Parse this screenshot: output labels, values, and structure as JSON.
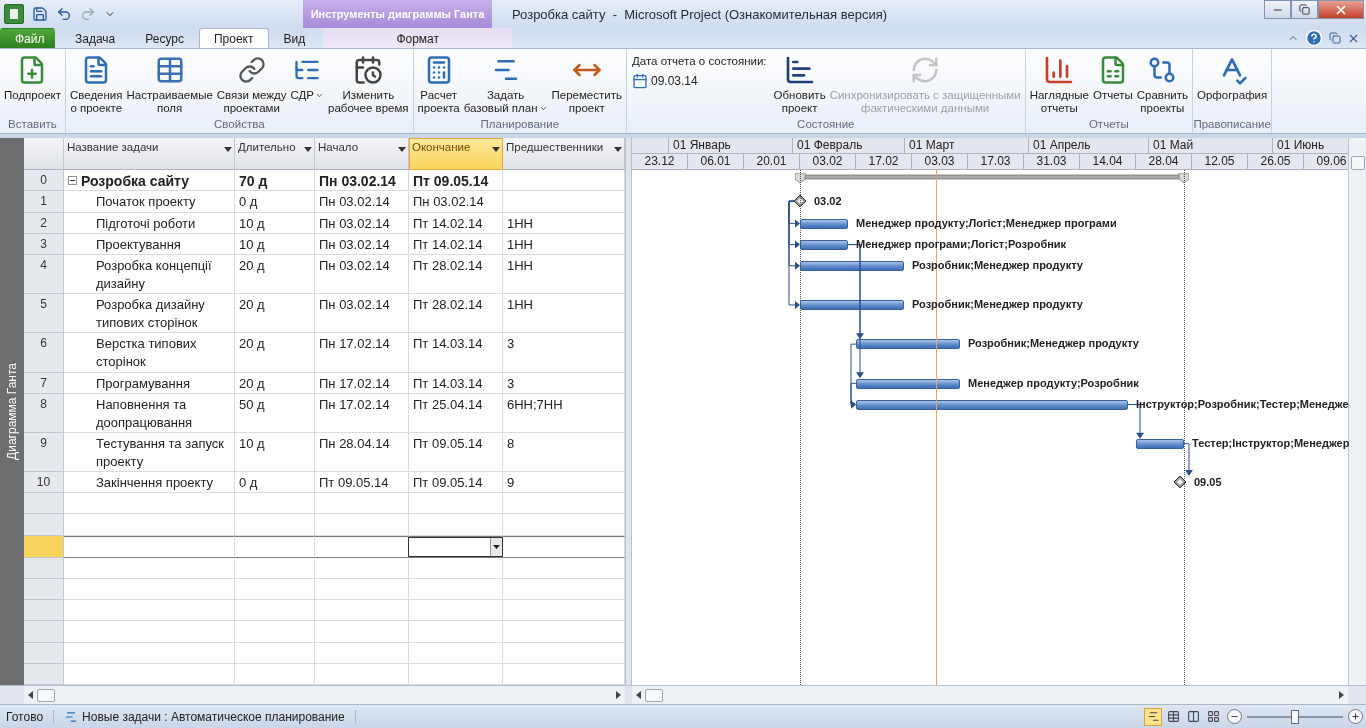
{
  "window": {
    "title": "Розробка сайту  -  Microsoft Project (Ознакомительная версия)"
  },
  "context_group": {
    "title": "Инструменты диаграммы Ганта"
  },
  "tabs": [
    {
      "label": "Файл",
      "kind": "file",
      "selected": false
    },
    {
      "label": "Задача",
      "kind": "tab",
      "selected": false
    },
    {
      "label": "Ресурс",
      "kind": "tab",
      "selected": false
    },
    {
      "label": "Проект",
      "kind": "tab",
      "selected": true
    },
    {
      "label": "Вид",
      "kind": "tab",
      "selected": false
    },
    {
      "label": "Формат",
      "kind": "context",
      "selected": false
    }
  ],
  "ribbon": {
    "groups": [
      {
        "label": "Вставить",
        "items": [
          {
            "kind": "button",
            "label": "Подпроект",
            "disabled": false,
            "dropdown": false
          }
        ]
      },
      {
        "label": "Свойства",
        "items": [
          {
            "kind": "button",
            "label": "Сведения\nо проекте",
            "disabled": false,
            "dropdown": false
          },
          {
            "kind": "button",
            "label": "Настраиваемые\nполя",
            "disabled": false,
            "dropdown": false
          },
          {
            "kind": "button",
            "label": "Связи между\nпроектами",
            "disabled": false,
            "dropdown": false
          },
          {
            "kind": "button",
            "label": "СДР",
            "disabled": false,
            "dropdown": true
          },
          {
            "kind": "button",
            "label": "Изменить\nрабочее время",
            "disabled": false,
            "dropdown": false
          }
        ]
      },
      {
        "label": "Планирование",
        "items": [
          {
            "kind": "button",
            "label": "Расчет\nпроекта",
            "disabled": false,
            "dropdown": false
          },
          {
            "kind": "button",
            "label": "Задать\nбазовый план",
            "disabled": false,
            "dropdown": true
          },
          {
            "kind": "button",
            "label": "Переместить\nпроект",
            "disabled": false,
            "dropdown": false
          }
        ]
      },
      {
        "label": "Состояние",
        "items": [
          {
            "kind": "date",
            "label": "Дата отчета о состоянии:",
            "value": "09.03.14"
          },
          {
            "kind": "button",
            "label": "Обновить\nпроект",
            "disabled": false,
            "dropdown": false
          },
          {
            "kind": "button",
            "label": "Синхронизировать с защищенными\nфактическими данными",
            "disabled": true,
            "dropdown": false
          }
        ]
      },
      {
        "label": "Отчеты",
        "items": [
          {
            "kind": "button",
            "label": "Наглядные\nотчеты",
            "disabled": false,
            "dropdown": false
          },
          {
            "kind": "button",
            "label": "Отчеты",
            "disabled": false,
            "dropdown": false
          },
          {
            "kind": "button",
            "label": "Сравнить\nпроекты",
            "disabled": false,
            "dropdown": false
          }
        ]
      },
      {
        "label": "Правописание",
        "items": [
          {
            "kind": "button",
            "label": "Орфография",
            "disabled": false,
            "dropdown": false
          }
        ]
      }
    ]
  },
  "view_bar": {
    "label": "Диаграмма Ганта"
  },
  "table": {
    "columns": [
      {
        "label": "Название задачи",
        "selected": false
      },
      {
        "label": "Длительно",
        "selected": false
      },
      {
        "label": "Начало",
        "selected": false
      },
      {
        "label": "Окончание",
        "selected": true
      },
      {
        "label": "Предшественники",
        "selected": false
      }
    ],
    "rows": [
      {
        "id": "0",
        "kind": "summary",
        "name": "Розробка сайту",
        "duration": "70 д",
        "start": "Пн 03.02.14",
        "finish": "Пт 09.05.14",
        "expanded": true,
        "children": [
          {
            "id": "1",
            "kind": "milestone",
            "name": "Початок проекту",
            "duration": "0 д",
            "start": "Пн 03.02.14",
            "finish": "Пн 03.02.14",
            "bar_label": "03.02"
          },
          {
            "id": "2",
            "kind": "task",
            "name": "Підготочі роботи",
            "duration": "10 д",
            "start": "Пн 03.02.14",
            "finish": "Пт 14.02.14",
            "predecessors": "1НН",
            "bar_label": "Менеджер продукту;Логіст;Менеджер програми"
          },
          {
            "id": "3",
            "kind": "task",
            "name": "Проектування",
            "duration": "10 д",
            "start": "Пн 03.02.14",
            "finish": "Пт 14.02.14",
            "predecessors": "1НН",
            "bar_label": "Менеджер програми;Логіст;Розробник"
          },
          {
            "id": "4",
            "kind": "task",
            "name": "Розробка концепції дизайну",
            "duration": "20 д",
            "start": "Пн 03.02.14",
            "finish": "Пт 28.02.14",
            "predecessors": "1НН",
            "bar_label": "Розробник;Менеджер продукту"
          },
          {
            "id": "5",
            "kind": "task",
            "name": "Розробка дизайну типових сторінок",
            "duration": "20 д",
            "start": "Пн 03.02.14",
            "finish": "Пт 28.02.14",
            "predecessors": "1НН",
            "bar_label": "Розробник;Менеджер продукту"
          },
          {
            "id": "6",
            "kind": "task",
            "name": "Верстка типових сторінок",
            "duration": "20 д",
            "start": "Пн 17.02.14",
            "finish": "Пт 14.03.14",
            "predecessors": "3",
            "bar_label": "Розробник;Менеджер продукту"
          },
          {
            "id": "7",
            "kind": "task",
            "name": "Програмування",
            "duration": "20 д",
            "start": "Пн 17.02.14",
            "finish": "Пт 14.03.14",
            "predecessors": "3",
            "bar_label": "Менеджер продукту;Розробник"
          },
          {
            "id": "8",
            "kind": "task",
            "name": "Наповнення та доопрацювання",
            "duration": "50 д",
            "start": "Пн 17.02.14",
            "finish": "Пт 25.04.14",
            "predecessors": "6НН;7НН",
            "bar_label": "Інструктор;Розробник;Тестер;Менедже"
          },
          {
            "id": "9",
            "kind": "task",
            "name": "Тестування та запуск проекту",
            "duration": "10 д",
            "start": "Пн 28.04.14",
            "finish": "Пт 09.05.14",
            "predecessors": "8",
            "bar_label": "Тестер;Інструктор;Менеджер"
          },
          {
            "id": "10",
            "kind": "milestone",
            "name": "Закінчення проекту",
            "duration": "0 д",
            "start": "Пт 09.05.14",
            "finish": "Пт 09.05.14",
            "predecessors": "9",
            "bar_label": "09.05"
          }
        ]
      }
    ],
    "blank_rows": [
      {
        "selected": false
      },
      {
        "selected": false
      },
      {
        "selected": true
      },
      {
        "selected": false
      },
      {
        "selected": false
      },
      {
        "selected": false
      },
      {
        "selected": false
      },
      {
        "selected": false
      },
      {
        "selected": false
      }
    ]
  },
  "timescale": {
    "months": [
      "01 Январь",
      "01 Февраль",
      "01 Март",
      "01 Апрель",
      "01 Май",
      "01 Июнь"
    ],
    "weeks": [
      "23.12",
      "06.01",
      "20.01",
      "03.02",
      "17.02",
      "03.03",
      "17.03",
      "31.03",
      "14.04",
      "28.04",
      "12.05",
      "26.05",
      "09.06"
    ]
  },
  "status_bar": {
    "ready": "Готово",
    "mode": "Новые задачи : Автоматическое планирование",
    "views": [
      {
        "selected": true
      },
      {
        "selected": false
      },
      {
        "selected": false
      },
      {
        "selected": false
      }
    ],
    "zoom": {
      "level": 0.5
    }
  }
}
